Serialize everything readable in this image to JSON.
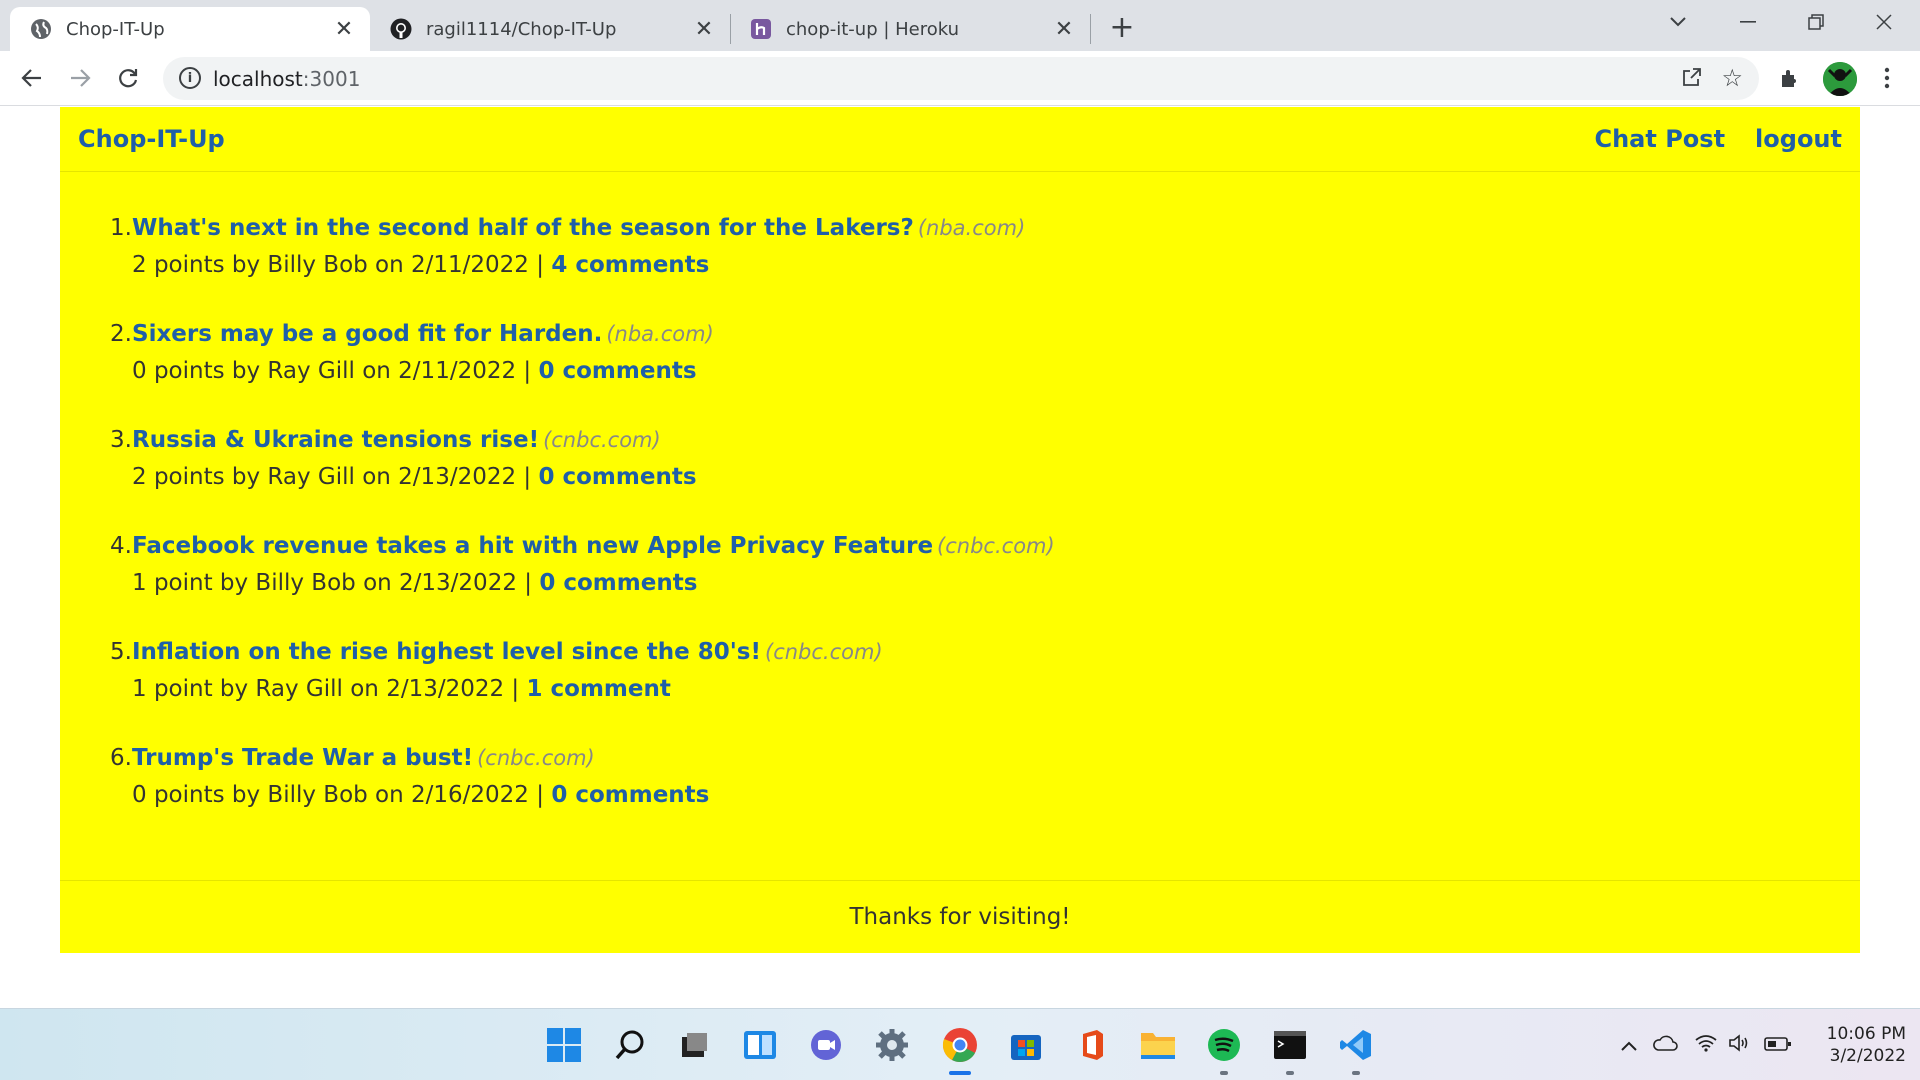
{
  "browser": {
    "tabs": [
      {
        "title": "Chop-IT-Up",
        "active": true,
        "icon": "globe-icon"
      },
      {
        "title": "ragil1114/Chop-IT-Up",
        "active": false,
        "icon": "github-icon"
      },
      {
        "title": "chop-it-up | Heroku",
        "active": false,
        "icon": "heroku-icon"
      }
    ],
    "url_host": "localhost",
    "url_port": ":3001"
  },
  "site": {
    "brand": "Chop-IT-Up",
    "nav": {
      "chat_post": "Chat Post",
      "logout": "logout"
    },
    "stories": [
      {
        "num": "1.",
        "title": "What's next in the second half of the season for the Lakers?",
        "domain": "(nba.com)",
        "meta": "2 points by Billy Bob on 2/11/2022 | ",
        "comments": "4 comments"
      },
      {
        "num": "2.",
        "title": "Sixers may be a good fit for Harden.",
        "domain": "(nba.com)",
        "meta": "0 points by Ray Gill on 2/11/2022 | ",
        "comments": "0 comments"
      },
      {
        "num": "3.",
        "title": "Russia & Ukraine tensions rise!",
        "domain": "(cnbc.com)",
        "meta": "2 points by Ray Gill on 2/13/2022 | ",
        "comments": "0 comments"
      },
      {
        "num": "4.",
        "title": "Facebook revenue takes a hit with new Apple Privacy Feature",
        "domain": "(cnbc.com)",
        "meta": "1 point by Billy Bob on 2/13/2022 | ",
        "comments": "0 comments"
      },
      {
        "num": "5.",
        "title": "Inflation on the rise highest level since the 80's!",
        "domain": "(cnbc.com)",
        "meta": "1 point by Ray Gill on 2/13/2022 | ",
        "comments": "1 comment"
      },
      {
        "num": "6.",
        "title": "Trump's Trade War a bust!",
        "domain": "(cnbc.com)",
        "meta": "0 points by Billy Bob on 2/16/2022 | ",
        "comments": "0 comments"
      }
    ],
    "footer": "Thanks for visiting!"
  },
  "taskbar": {
    "time": "10:06 PM",
    "date": "3/2/2022"
  },
  "colors": {
    "site_background": "#ffff00",
    "link": "#1f5fa8",
    "chrome_tabstrip": "#dee1e6"
  }
}
